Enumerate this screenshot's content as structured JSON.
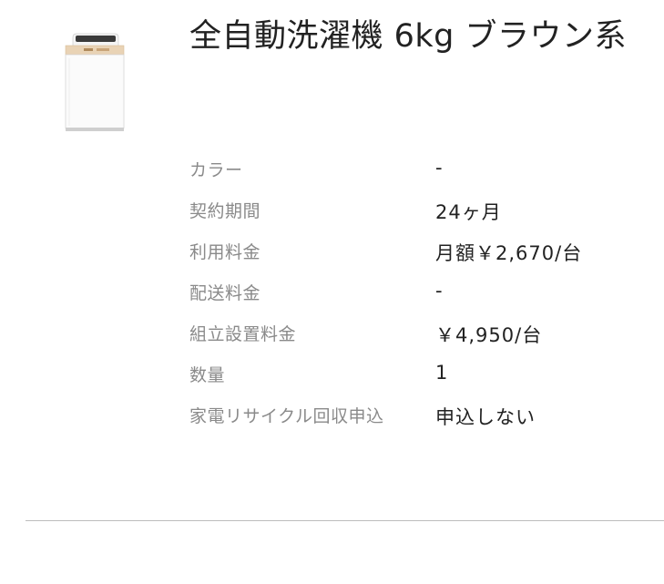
{
  "product": {
    "title": "全自動洗濯機 6kg ブラウン系",
    "image_alt": "全自動洗濯機"
  },
  "specs": [
    {
      "label": "カラー",
      "value": "-"
    },
    {
      "label": "契約期間",
      "value": "24ヶ月"
    },
    {
      "label": "利用料金",
      "value": "月額￥2,670/台"
    },
    {
      "label": "配送料金",
      "value": "-"
    },
    {
      "label": "組立設置料金",
      "value": "￥4,950/台"
    },
    {
      "label": "数量",
      "value": "1"
    },
    {
      "label": "家電リサイクル回収申込",
      "value": "申込しない"
    }
  ],
  "colors": {
    "label": "#8a8a8a",
    "value": "#222222",
    "divider": "#bdbdbd",
    "accent_band": "#e9d3b5"
  }
}
